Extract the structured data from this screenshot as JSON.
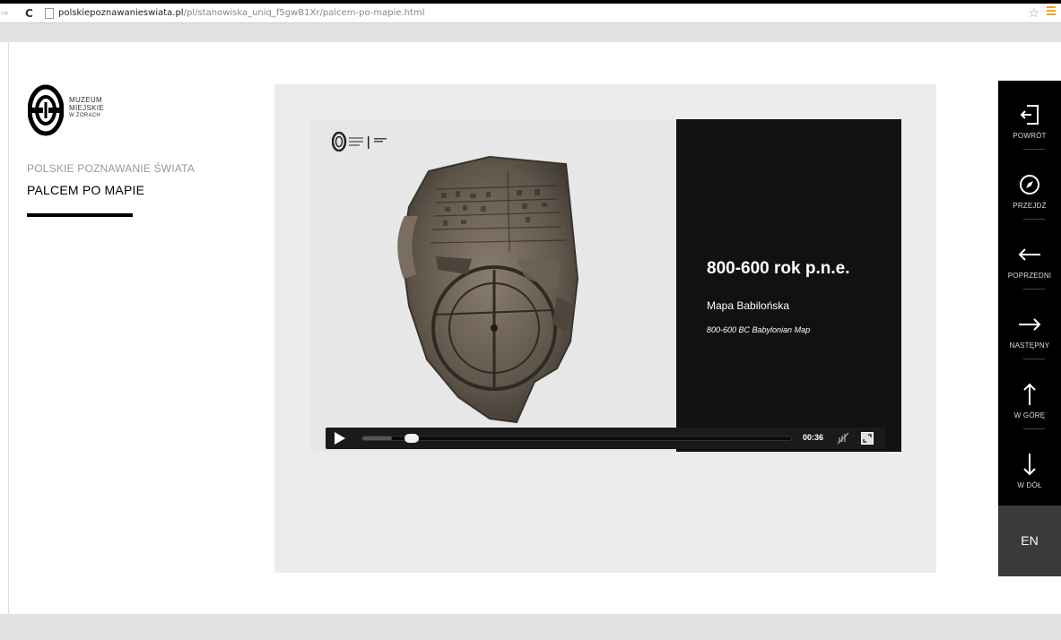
{
  "browser": {
    "url_domain": "polskiepoznawanieswiata.pl",
    "url_path": "/pl/stanowiska_uniq_f5gwB1Xr/palcem-po-mapie.html"
  },
  "sidebar": {
    "logo": {
      "line1": "MUZEUM",
      "line2": "MIEJSKIE",
      "line3": "W ŻORACH"
    },
    "subtitle": "POLSKIE POZNAWANIE ŚWIATA",
    "title": "PALCEM PO MAPIE"
  },
  "slide": {
    "year": "800-600 rok p.n.e.",
    "name_pl": "Mapa Babilońska",
    "name_en": "800-600 BC Babylonian Map"
  },
  "video": {
    "time": "00:36",
    "progress_fraction": 0.07
  },
  "right_nav": {
    "items": [
      {
        "label": "POWRÓT",
        "icon": "exit-icon"
      },
      {
        "label": "PRZEJDŹ",
        "icon": "compass-icon"
      },
      {
        "label": "POPRZEDNI",
        "icon": "arrow-left-icon"
      },
      {
        "label": "NASTĘPNY",
        "icon": "arrow-right-icon"
      },
      {
        "label": "W GÓRĘ",
        "icon": "arrow-up-icon"
      },
      {
        "label": "W DÓŁ",
        "icon": "arrow-down-icon"
      }
    ],
    "lang": "EN"
  },
  "colors": {
    "accent_dark": "#000000",
    "content_bg": "#ececec",
    "nav_lang_bg": "#3a3a3a"
  }
}
